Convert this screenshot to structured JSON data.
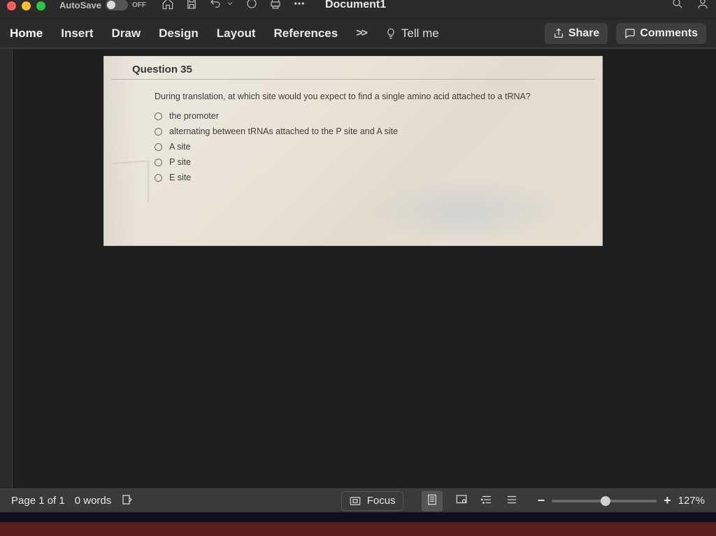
{
  "titlebar": {
    "autosave_label": "AutoSave",
    "autosave_state": "OFF",
    "doc_title": "Document1"
  },
  "ribbon": {
    "tabs": {
      "home": "Home",
      "insert": "Insert",
      "draw": "Draw",
      "design": "Design",
      "layout": "Layout",
      "references": "References"
    },
    "more": ">>",
    "tellme": "Tell me",
    "share": "Share",
    "comments": "Comments"
  },
  "question": {
    "header": "Question 35",
    "prompt": "During translation, at which site would you expect to find a single amino acid attached to a tRNA?",
    "opts": {
      "a": "the promoter",
      "b": "alternating between tRNAs attached to the P site and A site",
      "c": "A site",
      "d": "P site",
      "e": "E site"
    }
  },
  "status": {
    "page": "Page 1 of 1",
    "words": "0 words",
    "focus": "Focus",
    "zoom_minus": "−",
    "zoom_plus": "+",
    "zoom_pct": "127%"
  }
}
